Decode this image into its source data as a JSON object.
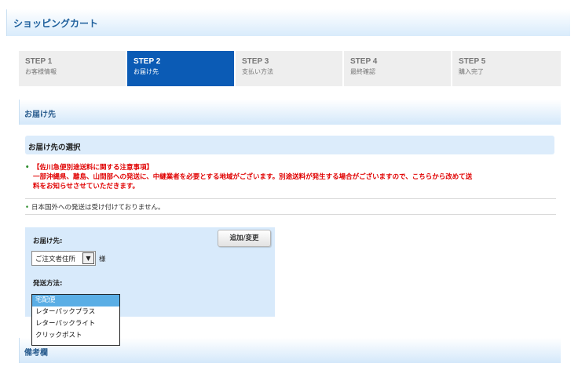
{
  "page": {
    "title": "ショッピングカート"
  },
  "steps": [
    {
      "no": "STEP 1",
      "name": "お客様情報",
      "active": false
    },
    {
      "no": "STEP 2",
      "name": "お届け先",
      "active": true
    },
    {
      "no": "STEP 3",
      "name": "支払い方法",
      "active": false
    },
    {
      "no": "STEP 4",
      "name": "最終確認",
      "active": false
    },
    {
      "no": "STEP 5",
      "name": "購入完了",
      "active": false
    }
  ],
  "delivery": {
    "section_title": "お届け先",
    "sub_title": "お届け先の選択",
    "notice_title": "【佐川急便別途送料に関する注意事項】",
    "notice_line1": "一部沖縄県、離島、山間部への発送に、中継業者を必要とする地域がございます。別途送料が発生する場合がございますので、こちらから改めて送",
    "notice_line2": "料をお知らせさせていただきます。",
    "note": "日本国外への発送は受け付けておりません。",
    "form": {
      "add_button": "追加/変更",
      "address_label": "お届け先:",
      "address_selected": "ご注文者住所",
      "address_suffix": "様",
      "shipping_label": "発送方法:",
      "shipping_options": [
        "宅配便",
        "レターパックプラス",
        "レターパックライト",
        "クリックポスト"
      ],
      "shipping_selected_index": 0
    }
  },
  "remarks": {
    "section_title": "備考欄"
  },
  "colors": {
    "accent": "#0b5bb5",
    "notice": "#e00000",
    "header_text": "#20619d",
    "highlight": "#5aaee5"
  }
}
